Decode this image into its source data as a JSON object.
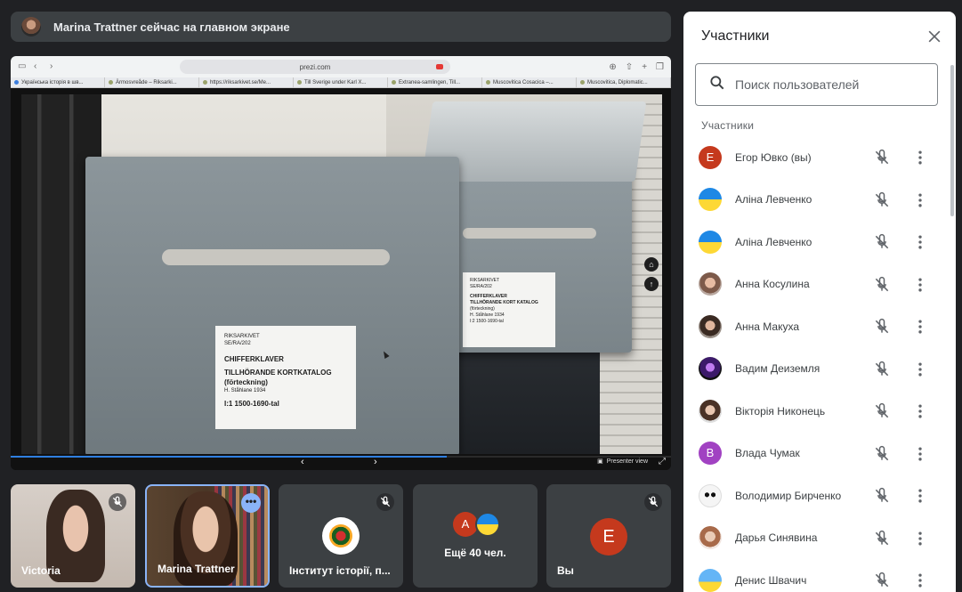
{
  "banner": {
    "text": "Marina Trattner сейчас на главном экране"
  },
  "browser": {
    "url": "prezi.com",
    "tabs": [
      "Українська історія в шв...",
      "Ärmosvreåde – Riksarki...",
      "https://riksarkivet.se/Me...",
      "Till Sverige under Karl X...",
      "Extranea-samlingen, Till...",
      "Muscovitica Cosacica –...",
      "Muscovitica, Diplomatic..."
    ]
  },
  "slide": {
    "front_label": {
      "l1": "RIKSARKIVET",
      "l2": "SE/RA/202",
      "l3": "CHIFFERKLAVER",
      "l4": "TILLHÖRANDE KORTKATALOG",
      "l5": "(förteckning)",
      "l6": "H. Ståhlane 1934",
      "l7": "I:1 1500-1690-tal"
    },
    "back_label": {
      "l1": "RIKSARKIVET",
      "l2": "SE/RA/202",
      "l3": "CHIFFERKLAVER",
      "l4": "TILLHÖRANDE KORT KATALOG",
      "l5": "(förteckning)",
      "l6": "H. Ståhlane 1934",
      "l7": "I:2 1500-1690-tal"
    },
    "progress": 0.66,
    "presenter_view": "Presenter view"
  },
  "tiles": [
    {
      "name": "Victoria",
      "muted": true
    },
    {
      "name": "Marina Trattner",
      "more_label": "•••"
    },
    {
      "name": "Інститут історії, п...",
      "muted": true
    },
    {
      "name": "Ещё 40 чел.",
      "avatar_letter": "A"
    },
    {
      "name": "Вы",
      "avatar_letter": "E",
      "muted": true
    }
  ],
  "panel": {
    "title": "Участники",
    "search_placeholder": "Поиск пользователей",
    "section": "Участники",
    "participants": [
      {
        "name": "Егор Ювко (вы)",
        "avatar": "E",
        "color": "#c5391d"
      },
      {
        "name": "Аліна Левченко",
        "avatar": "flag"
      },
      {
        "name": "Аліна Левченко",
        "avatar": "flag"
      },
      {
        "name": "Анна Косулина",
        "avatar": "photo1"
      },
      {
        "name": "Анна Макуха",
        "avatar": "photo2"
      },
      {
        "name": "Вадим Деиземля",
        "avatar": "photo3"
      },
      {
        "name": "Вікторія Никонець",
        "avatar": "photo4"
      },
      {
        "name": "Влада Чумак",
        "avatar": "B",
        "color": "#a142c2"
      },
      {
        "name": "Володимир Бирченко",
        "avatar": "panda"
      },
      {
        "name": "Дарья Синявина",
        "avatar": "photo5"
      },
      {
        "name": "Денис Швачич",
        "avatar": "sky"
      }
    ]
  }
}
